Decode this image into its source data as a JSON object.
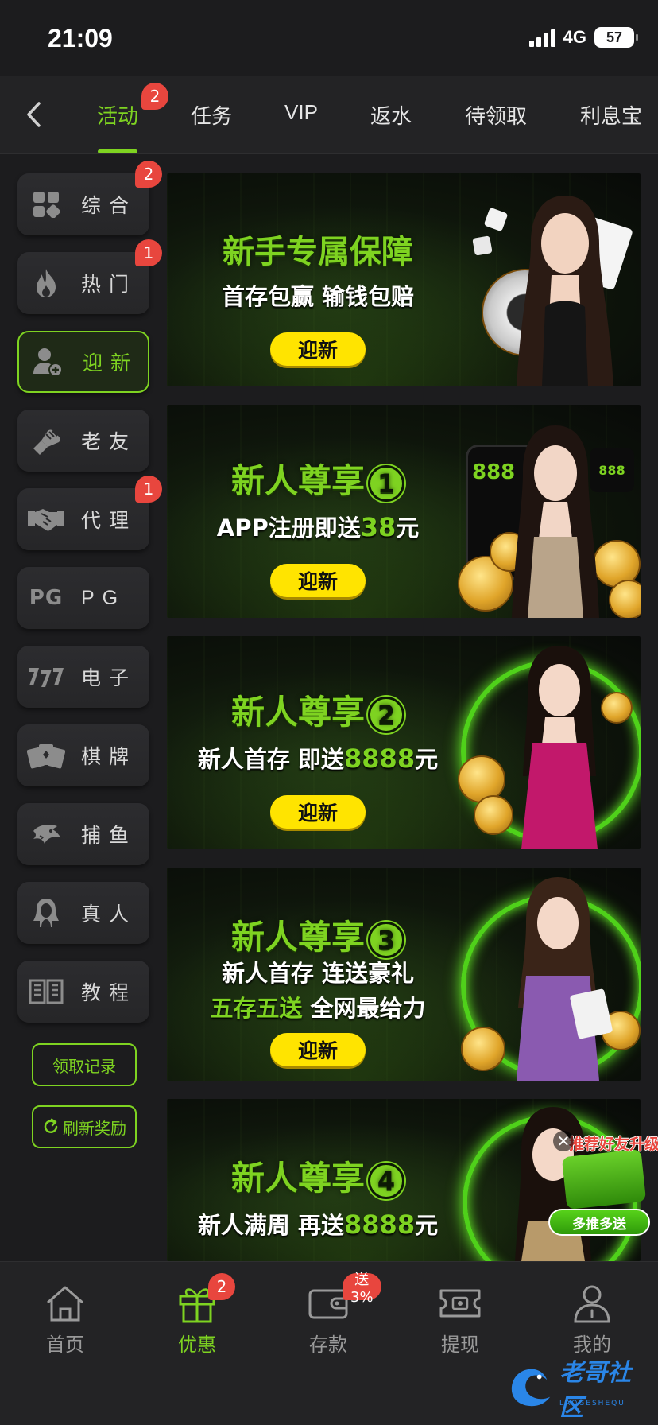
{
  "status_bar": {
    "time": "21:09",
    "network": "4G",
    "battery": "57"
  },
  "top_tabs": [
    {
      "label": "活动",
      "badge": "2",
      "active": true
    },
    {
      "label": "任务"
    },
    {
      "label": "VIP"
    },
    {
      "label": "返水"
    },
    {
      "label": "待领取"
    },
    {
      "label": "利息宝"
    }
  ],
  "sidebar": {
    "items": [
      {
        "label": "综合",
        "icon": "grid-icon",
        "badge": "2"
      },
      {
        "label": "热门",
        "icon": "flame-icon",
        "badge": "1"
      },
      {
        "label": "迎新",
        "icon": "add-user-icon",
        "active": true
      },
      {
        "label": "老友",
        "icon": "fist-bump-icon"
      },
      {
        "label": "代理",
        "icon": "handshake-icon",
        "badge": "1"
      },
      {
        "label": "PG",
        "icon_text": "PG"
      },
      {
        "label": "电子",
        "icon": "slot-777-icon"
      },
      {
        "label": "棋牌",
        "icon": "cards-icon"
      },
      {
        "label": "捕鱼",
        "icon": "shark-icon"
      },
      {
        "label": "真人",
        "icon": "dealer-icon"
      },
      {
        "label": "教程",
        "icon": "book-icon"
      }
    ],
    "claim_record": "领取记录",
    "refresh_rewards": "刷新奖励"
  },
  "banners": [
    {
      "title": "新手专属保障",
      "line1": "首存包赢 输钱包赔",
      "button": "迎新"
    },
    {
      "title": "新人尊享",
      "number": "1",
      "line1_pre": "APP注册即送",
      "line1_hl": "38",
      "line1_post": "元",
      "button": "迎新"
    },
    {
      "title": "新人尊享",
      "number": "2",
      "line1_pre": "新人首存 即送",
      "line1_hl": "8888",
      "line1_post": "元",
      "button": "迎新"
    },
    {
      "title": "新人尊享",
      "number": "3",
      "line1": "新人首存 连送豪礼",
      "line2_hl": "五存五送",
      "line2_post": " 全网最给力",
      "button": "迎新"
    },
    {
      "title": "新人尊享",
      "number": "4",
      "line1_pre": "新人满周 再送",
      "line1_hl": "8888",
      "line1_post": "元"
    }
  ],
  "floating_promo": {
    "title": "推荐好友升级",
    "button": "多推多送",
    "close": "✕"
  },
  "bottom_nav": [
    {
      "label": "首页",
      "icon": "home-icon"
    },
    {
      "label": "优惠",
      "icon": "gift-icon",
      "badge": "2",
      "active": true
    },
    {
      "label": "存款",
      "icon": "wallet-icon",
      "badge": "送3%"
    },
    {
      "label": "提现",
      "icon": "withdraw-icon"
    },
    {
      "label": "我的",
      "icon": "profile-icon"
    }
  ],
  "watermark": {
    "text": "老哥社区",
    "sub": "LAOGESHEQU"
  },
  "colors": {
    "accent": "#7ed321",
    "badge": "#e8463e",
    "pill": "#ffe400",
    "background": "#1c1c1e"
  }
}
